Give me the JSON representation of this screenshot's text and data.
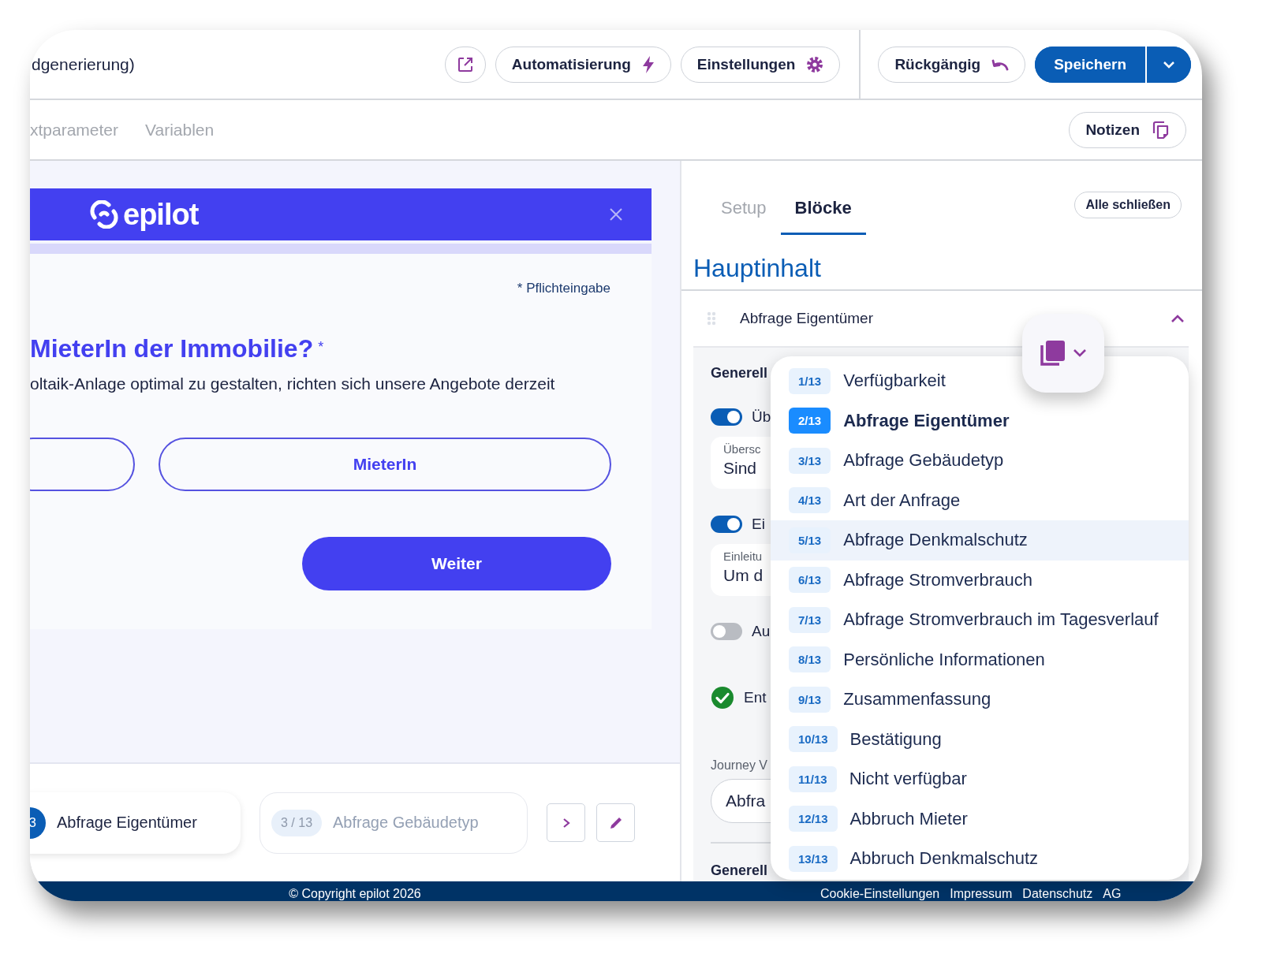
{
  "header": {
    "title": "dgenerierung)",
    "buttons": [
      {
        "label": "Automatisierung",
        "kind": "bolt"
      },
      {
        "label": "Einstellungen",
        "kind": "gear"
      }
    ],
    "undo": "Rückgängig",
    "save": "Speichern"
  },
  "subnav": {
    "tabs": [
      {
        "label": "xtparameter",
        "selected": false
      },
      {
        "label": "Variablen",
        "selected": false
      }
    ],
    "notes_button": "Notizen"
  },
  "preview": {
    "brand": "epilot",
    "progress": {
      "level": 1
    },
    "required_note": "* Pflichteingabe",
    "question": "MieterIn der Immobilie?",
    "required_mark": "*",
    "description": "oltaik-Anlage optimal zu gestalten, richten sich unsere Angebote derzeit",
    "options": [
      {
        "selected": false
      },
      {
        "label": "MieterIn",
        "selected": false
      }
    ],
    "next_button": "Weiter"
  },
  "step_nav": {
    "current": {
      "number": "3",
      "title": "Abfrage Eigentümer"
    },
    "next": {
      "badge": "3 / 13",
      "title": "Abfrage Gebäudetyp"
    }
  },
  "footer": {
    "copyright": "© Copyright epilot 2026",
    "links": [
      "Cookie-Einstellungen",
      "Impressum",
      "Datenschutz",
      "AG"
    ]
  },
  "editor": {
    "tabs": [
      {
        "label": "Setup",
        "selected": false
      },
      {
        "label": "Blöcke",
        "selected": true
      }
    ],
    "collapse_all": "Alle schließen",
    "section_title": "Hauptinhalt",
    "block": {
      "title": "Abfrage Eigentümer",
      "expanded": true
    },
    "settings": [
      {
        "kind": "heading",
        "label": "Generell"
      },
      {
        "kind": "toggle",
        "label": "Üb",
        "on": true
      },
      {
        "kind": "field",
        "label": "Übersc",
        "value": "Sind"
      },
      {
        "kind": "toggle",
        "label": "Ei",
        "on": true
      },
      {
        "kind": "field",
        "label": "Einleitu",
        "value": "Um d"
      },
      {
        "kind": "toggle",
        "label": "Au",
        "on": false
      },
      {
        "kind": "check",
        "label": "Ent"
      },
      {
        "kind": "select",
        "label": "Journey V",
        "value": "Abfra"
      },
      {
        "kind": "divider"
      },
      {
        "kind": "heading",
        "label": "Generell"
      }
    ]
  },
  "block_menu": {
    "items": [
      {
        "badge": "1/13",
        "label": "Verfügbarkeit",
        "selected": false,
        "highlighted": false
      },
      {
        "badge": "2/13",
        "label": "Abfrage Eigentümer",
        "selected": true,
        "highlighted": false
      },
      {
        "badge": "3/13",
        "label": "Abfrage Gebäudetyp",
        "selected": false,
        "highlighted": false
      },
      {
        "badge": "4/13",
        "label": "Art der Anfrage",
        "selected": false,
        "highlighted": false
      },
      {
        "badge": "5/13",
        "label": "Abfrage Denkmalschutz",
        "selected": false,
        "highlighted": true
      },
      {
        "badge": "6/13",
        "label": "Abfrage Stromverbrauch",
        "selected": false,
        "highlighted": false
      },
      {
        "badge": "7/13",
        "label": "Abfrage Stromverbrauch im Tagesverlauf",
        "selected": false,
        "highlighted": false
      },
      {
        "badge": "8/13",
        "label": "Persönliche Informationen",
        "selected": false,
        "highlighted": false
      },
      {
        "badge": "9/13",
        "label": "Zusammenfassung",
        "selected": false,
        "highlighted": false
      },
      {
        "badge": "10/13",
        "label": "Bestätigung",
        "selected": false,
        "highlighted": false
      },
      {
        "badge": "11/13",
        "label": "Nicht verfügbar",
        "selected": false,
        "highlighted": false
      },
      {
        "badge": "12/13",
        "label": "Abbruch Mieter",
        "selected": false,
        "highlighted": false
      },
      {
        "badge": "13/13",
        "label": "Abbruch Denkmalschutz",
        "selected": false,
        "highlighted": false
      }
    ]
  }
}
